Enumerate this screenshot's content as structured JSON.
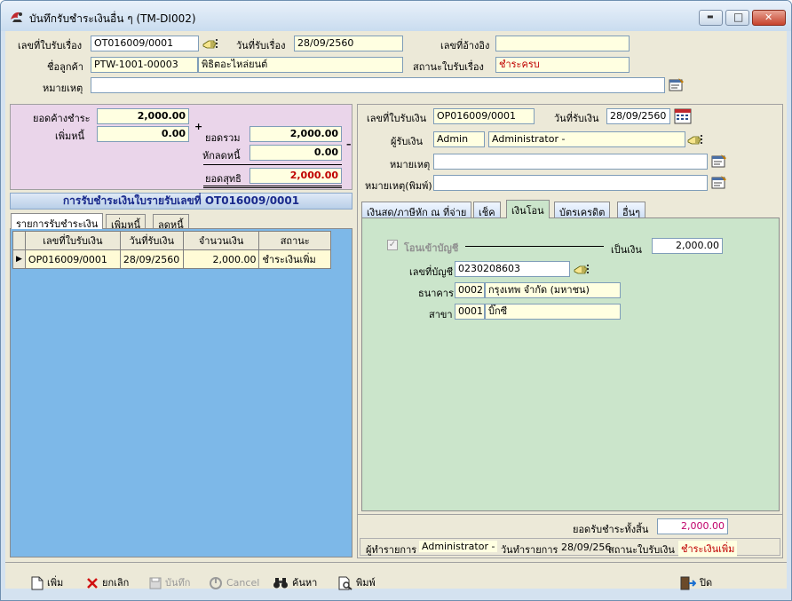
{
  "window": {
    "title": "บันทึกรับชำระเงินอื่น ๆ (TM-DI002)",
    "minimize_glyph": "▬",
    "maximize_glyph": "□",
    "close_glyph": "✕",
    "close_color": "#c7432c"
  },
  "header": {
    "doc_no_label": "เลขที่ใบรับเรื่อง",
    "doc_no_value": "OT016009/0001",
    "receive_date_label": "วันที่รับเรื่อง",
    "receive_date_value": "28/09/2560",
    "ref_no_label": "เลขที่อ้างอิง",
    "ref_no_value": "",
    "customer_label": "ชื่อลูกค้า",
    "customer_code": "PTW-1001-00003",
    "customer_name": "พิธิตอะไหล่ยนต์",
    "status_label": "สถานะใบรับเรื่อง",
    "status_value": "ชำระครบ",
    "remark_label": "หมายเหตุ",
    "remark_value": ""
  },
  "summary": {
    "outstanding_label": "ยอดค้างชำระ",
    "outstanding_value": "2,000.00",
    "increase_label": "เพิ่มหนี้",
    "increase_value": "0.00",
    "plus_sign": "+",
    "minus_sign": "–",
    "total_label": "ยอดรวม",
    "total_value": "2,000.00",
    "decrease_label": "หักลดหนี้",
    "decrease_value": "0.00",
    "net_label": "ยอดสุทธิ",
    "net_value": "2,000.00"
  },
  "left_panel": {
    "title": "การรับชำระเงินใบรายรับเลขที่ OT016009/0001",
    "tabs": [
      "รายการรับชำระเงิน",
      "เพิ่มหนี้",
      "ลดหนี้"
    ],
    "columns": [
      "เลขที่ใบรับเงิน",
      "วันที่รับเงิน",
      "จำนวนเงิน",
      "สถานะ"
    ],
    "rows": [
      {
        "receipt_no": "OP016009/0001",
        "date": "28/09/2560",
        "amount": "2,000.00",
        "status": "ชำระเงินเพิ่ม"
      }
    ],
    "row_indicator": "▶"
  },
  "right_panel": {
    "receipt_no_label": "เลขที่ใบรับเงิน",
    "receipt_no_value": "OP016009/0001",
    "receipt_date_label": "วันที่รับเงิน",
    "receipt_date_value": "28/09/2560",
    "receiver_label": "ผู้รับเงิน",
    "receiver_code": "Admin",
    "receiver_name": "Administrator -",
    "remark_label": "หมายเหตุ",
    "remark_value": "",
    "remark_print_label": "หมายเหตุ(พิมพ์)",
    "remark_print_value": "",
    "tabs": [
      "เงินสด/ภาษีหัก ณ ที่จ่าย",
      "เช็ค",
      "เงินโอน",
      "บัตรเครดิต",
      "อื่นๆ"
    ],
    "active_tab": "เงินโอน",
    "transfer": {
      "checkbox_label": "โอนเข้าบัญชี",
      "checkbox_mark": "✓",
      "amount_label": "เป็นเงิน",
      "amount_value": "2,000.00",
      "account_label": "เลขที่บัญชี",
      "account_value": "0230208603",
      "bank_label": "ธนาคาร",
      "bank_code": "0002",
      "bank_name": "กรุงเทพ จำกัด (มหาชน)",
      "branch_label": "สาขา",
      "branch_code": "0001",
      "branch_name": "บิ๊กซี"
    },
    "total_received_label": "ยอดรับชำระทั้งสิ้น",
    "total_received_value": "2,000.00",
    "footer": {
      "maker_label": "ผู้ทำรายการ",
      "maker_value": "Administrator -",
      "make_date_label": "วันทำรายการ",
      "make_date_value": "28/09/256",
      "status_label": "สถานะใบรับเงิน",
      "status_value": "ชำระเงินเพิ่ม"
    }
  },
  "toolbar": {
    "add_label": "เพิ่ม",
    "cancel_th_label": "ยกเลิก",
    "save_label": "บันทึก",
    "cancel_label": "Cancel",
    "search_label": "ค้นหา",
    "print_label": "พิมพ์",
    "close_label": "ปิด"
  },
  "colors": {
    "summary_bg": "#ead5ea",
    "transfer_bg": "#cbe5cb",
    "grid_bg": "#7db8e8",
    "active_tab_bg": "#cbe5cb",
    "status_red": "#c00000"
  }
}
